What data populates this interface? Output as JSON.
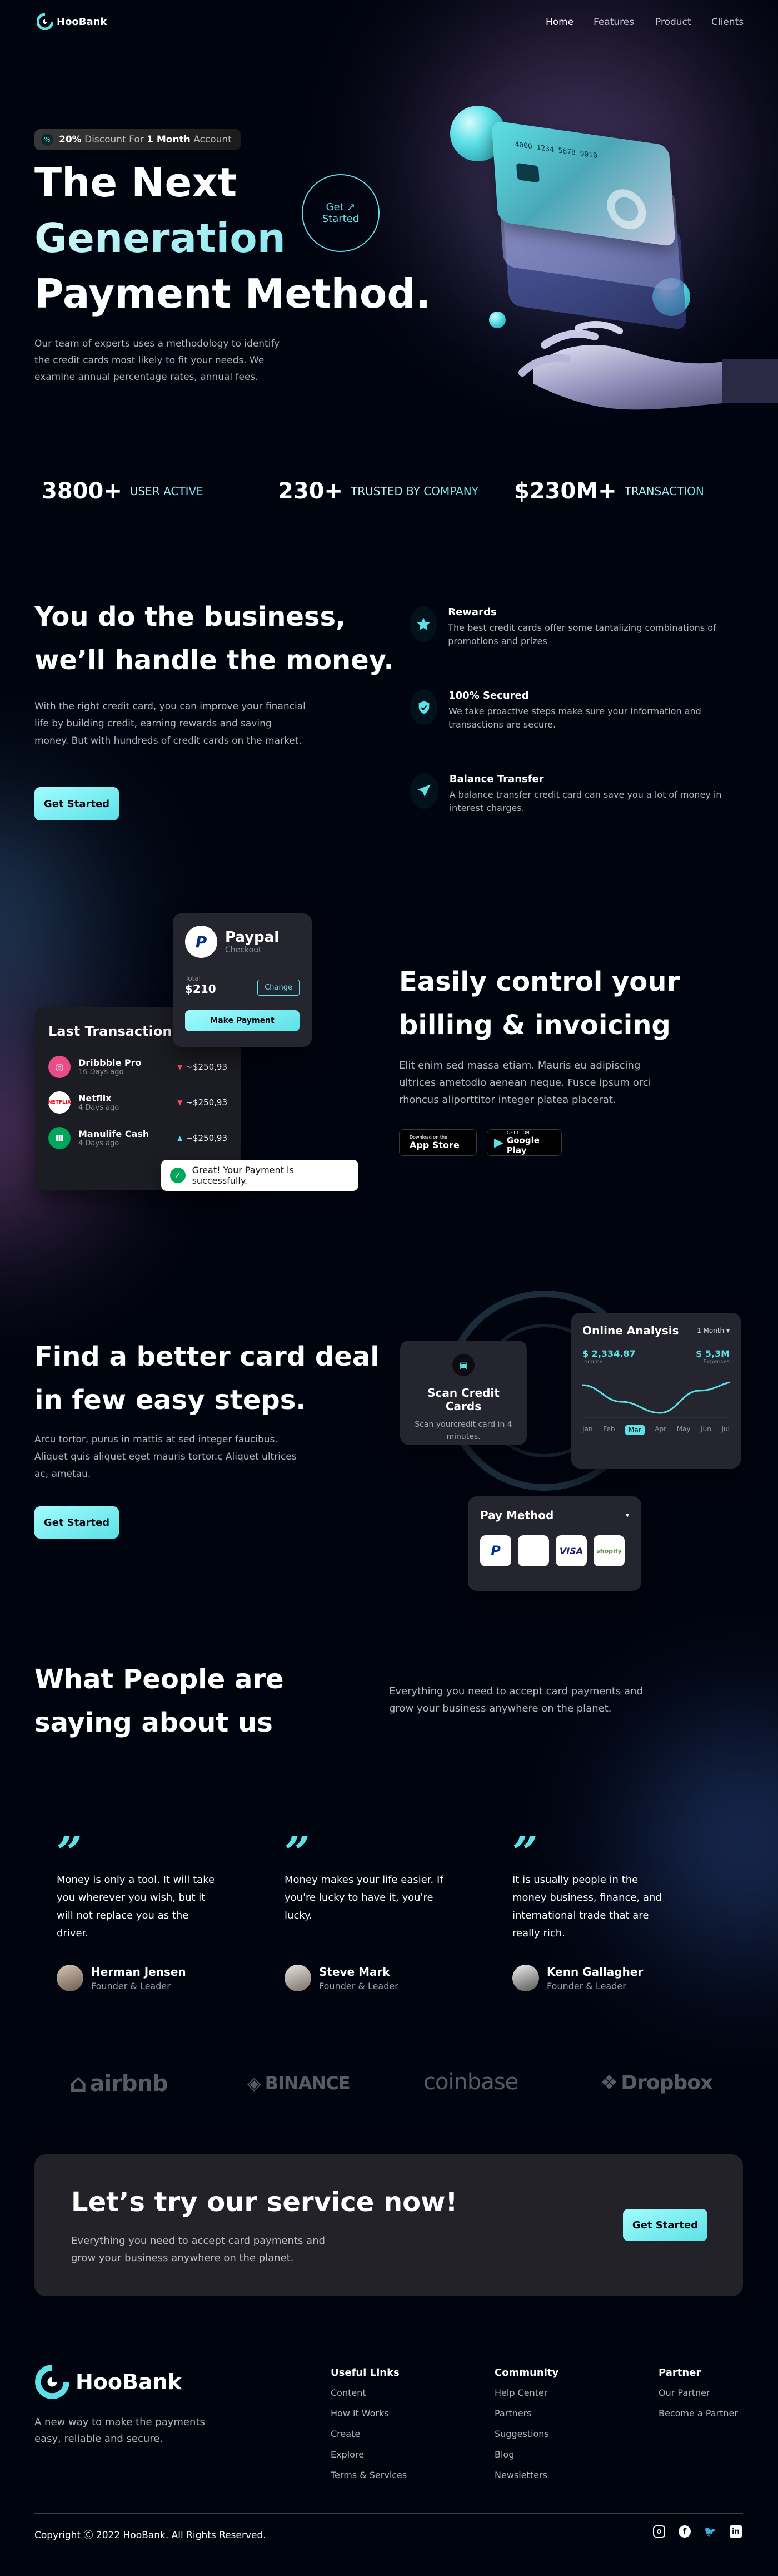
{
  "brand": {
    "name": "HooBank"
  },
  "nav": {
    "items": [
      "Home",
      "Features",
      "Product",
      "Clients"
    ]
  },
  "hero": {
    "badge_percent": "20%",
    "badge_middle": " Discount For ",
    "badge_month": "1 Month",
    "badge_suffix": " Account",
    "title_line1": "The Next",
    "title_line2": "Generation",
    "title_line3": "Payment Method.",
    "description": "Our team of experts uses a methodology to identify the credit cards most likely to fit your needs. We examine annual percentage rates, annual fees.",
    "get_started_1": "Get ↗",
    "get_started_2": "Started",
    "card_number": "4000 1234 5678 9010"
  },
  "stats": [
    {
      "value": "3800+",
      "label": "USER ACTIVE"
    },
    {
      "value": "230+",
      "label": "TRUSTED BY COMPANY"
    },
    {
      "value": "$230M+",
      "label": "TRANSACTION"
    }
  ],
  "business": {
    "title_line1": "You do the business,",
    "title_line2": "we’ll handle the money.",
    "description": "With the right credit card, you can improve your financial life by building credit, earning rewards and saving money. But with hundreds of credit cards on the market.",
    "button": "Get Started",
    "features": [
      {
        "icon": "star-icon",
        "title": "Rewards",
        "desc": "The best credit cards offer some tantalizing combinations of promotions and prizes"
      },
      {
        "icon": "shield-icon",
        "title": "100% Secured",
        "desc": "We take proactive steps make sure your information and transactions are secure."
      },
      {
        "icon": "send-icon",
        "title": "Balance Transfer",
        "desc": "A balance transfer credit card can save you a lot of money in interest charges."
      }
    ]
  },
  "billing": {
    "paypal_title": "Paypal",
    "paypal_sub": "Checkout",
    "total_label": "Total",
    "total_value": "$210",
    "change": "Change",
    "make_payment": "Make Payment",
    "last_txn_title": "Last Transaction",
    "transactions": [
      {
        "name": "Dribbble Pro",
        "date": "16 Days ago",
        "amount": "~$250,93",
        "color": "#ea4c89"
      },
      {
        "name": "Netflix",
        "date": "4 Days ago",
        "amount": "~$250,93",
        "color": "#e50914"
      },
      {
        "name": "Manulife Cash",
        "date": "4 Days ago",
        "amount": "~$250,93",
        "color": "#00a758"
      }
    ],
    "toast": "Great! Your Payment is successfully.",
    "title_line1": "Easily control your",
    "title_line2": "billing & invoicing",
    "description": "Elit enim sed massa etiam. Mauris eu adipiscing ultrices ametodio aenean neque. Fusce ipsum orci rhoncus aliporttitor integer platea placerat.",
    "appstore_small": "Download on the",
    "appstore_big": "App Store",
    "playstore_small": "GET IT ON",
    "playstore_big": "Google Play"
  },
  "deal": {
    "title_line1": "Find a better card deal",
    "title_line2": "in few easy steps.",
    "description": "Arcu tortor, purus in mattis at sed integer faucibus. Aliquet quis aliquet eget mauris tortor.ç Aliquet ultrices ac, ametau.",
    "button": "Get Started",
    "scan_title": "Scan Credit Cards",
    "scan_desc": "Scan yourcredit card in 4 minutes.",
    "analysis_title": "Online Analysis",
    "analysis_period": "1 Month",
    "income_value": "$ 2,334.87",
    "income_label": "Income",
    "expense_value": "$ 5,3M",
    "expense_label": "Expenses",
    "months": [
      "Jan",
      "Feb",
      "Mar",
      "Apr",
      "May",
      "Jun",
      "Jul"
    ],
    "active_month_index": 2,
    "pay_method_title": "Pay Method",
    "pay_methods": [
      "P",
      "",
      "VISA",
      "shopify"
    ]
  },
  "testimonials": {
    "title_line1": "What People are",
    "title_line2": "saying about us",
    "intro": "Everything you need to accept card payments and grow your business anywhere on the planet.",
    "items": [
      {
        "text": "Money is only a tool. It will take you wherever you wish, but it will not replace you as the driver.",
        "name": "Herman Jensen",
        "role": "Founder & Leader"
      },
      {
        "text": "Money makes your life easier. If you're lucky to have it, you're lucky.",
        "name": "Steve Mark",
        "role": "Founder & Leader"
      },
      {
        "text": "It is usually people in the money business, finance, and international trade that are really rich.",
        "name": "Kenn Gallagher",
        "role": "Founder & Leader"
      }
    ]
  },
  "partners": [
    "airbnb",
    "BINANCE",
    "coinbase",
    "Dropbox"
  ],
  "cta": {
    "title": "Let’s try our service now!",
    "description": "Everything you need to accept card payments and grow your business anywhere on the planet.",
    "button": "Get Started"
  },
  "footer": {
    "tagline": "A new way to make the payments easy, reliable and secure.",
    "columns": [
      {
        "title": "Useful Links",
        "links": [
          "Content",
          "How it Works",
          "Create",
          "Explore",
          "Terms & Services"
        ]
      },
      {
        "title": "Community",
        "links": [
          "Help Center",
          "Partners",
          "Suggestions",
          "Blog",
          "Newsletters"
        ]
      },
      {
        "title": "Partner",
        "links": [
          "Our Partner",
          "Become a Partner"
        ]
      }
    ],
    "copyright": "Copyright Ⓒ 2022 HooBank. All Rights Reserved.",
    "socials": [
      "instagram-icon",
      "facebook-icon",
      "twitter-icon",
      "linkedin-icon"
    ]
  },
  "colors": {
    "accent": "#5ce1e6",
    "background": "#00040f",
    "card": "#1f1f27"
  }
}
